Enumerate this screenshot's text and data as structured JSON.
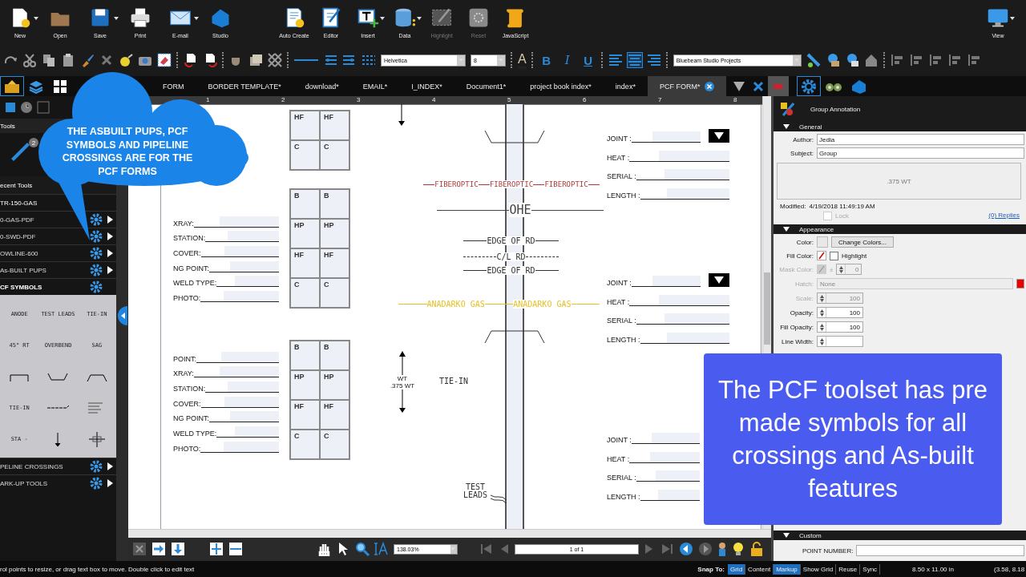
{
  "ribbon": {
    "groups": [
      [
        {
          "label": "New",
          "disabled": false
        },
        {
          "label": "Open",
          "disabled": false
        },
        {
          "label": "Save",
          "disabled": false
        },
        {
          "label": "Print",
          "disabled": false
        },
        {
          "label": "E-mail",
          "disabled": false
        },
        {
          "label": "Studio",
          "disabled": false
        }
      ],
      [
        {
          "label": "Auto Create",
          "disabled": false
        },
        {
          "label": "Editor",
          "disabled": false
        },
        {
          "label": "Insert",
          "disabled": false
        },
        {
          "label": "Data",
          "disabled": false
        },
        {
          "label": "Highlight",
          "disabled": true
        },
        {
          "label": "Reset",
          "disabled": true
        },
        {
          "label": "JavaScript",
          "disabled": false
        }
      ]
    ],
    "view": {
      "label": "View"
    }
  },
  "format_bar": {
    "font": "Helvetica",
    "size": "8",
    "color_glyph": "A",
    "styles": [
      {
        "label": "B",
        "kind": "bold"
      },
      {
        "label": "I",
        "kind": "italic"
      },
      {
        "label": "U",
        "kind": "underline"
      }
    ],
    "align": [
      {
        "selected": false
      },
      {
        "selected": true
      },
      {
        "selected": false
      }
    ],
    "profile": "Bluebeam Studio Projects"
  },
  "tabs": [
    {
      "label": "FORM",
      "selected": false
    },
    {
      "label": "BORDER TEMPLATE*",
      "selected": false
    },
    {
      "label": "download*",
      "selected": false
    },
    {
      "label": "EMAIL*",
      "selected": false
    },
    {
      "label": "I_INDEX*",
      "selected": false
    },
    {
      "label": "Document1*",
      "selected": false
    },
    {
      "label": "project book index*",
      "selected": false
    },
    {
      "label": "index*",
      "selected": false
    },
    {
      "label": "PCF FORM*",
      "selected": true
    }
  ],
  "tools_panel": {
    "header": "Tools",
    "badge": "2",
    "recent": {
      "label": "ecent Tools",
      "items": [
        "TR-150-GAS"
      ]
    },
    "toolsets": [
      {
        "label": "0-GAS-PDF",
        "expanded": false
      },
      {
        "label": "0-SWD-PDF",
        "expanded": false
      },
      {
        "label": "OWLINE-600",
        "expanded": false
      },
      {
        "label": "As-BUILT PUPS",
        "expanded": false
      },
      {
        "label": "CF SYMBOLS",
        "expanded": true
      },
      {
        "label": "PELINE CROSSINGS",
        "expanded": false
      },
      {
        "label": "ARK-UP TOOLS",
        "expanded": false
      }
    ],
    "symbols": [
      {
        "kind": "text",
        "label": "ANODE"
      },
      {
        "kind": "text",
        "label": "TEST LEADS"
      },
      {
        "kind": "text",
        "label": "TIE-IN"
      },
      {
        "kind": "text",
        "label": "45° RT"
      },
      {
        "kind": "text",
        "label": "OVERBEND"
      },
      {
        "kind": "text",
        "label": "SAG"
      },
      {
        "kind": "drawing"
      },
      {
        "kind": "drawing"
      },
      {
        "kind": "drawing"
      },
      {
        "kind": "text",
        "label": "TIE-IN"
      },
      {
        "kind": "drawing"
      },
      {
        "kind": "drawing"
      },
      {
        "kind": "text",
        "label": "STA -"
      },
      {
        "kind": "drawing"
      },
      {
        "kind": "drawing"
      }
    ]
  },
  "document": {
    "ruler": [
      "1",
      "2",
      "3",
      "4",
      "5",
      "6",
      "7",
      "8"
    ],
    "left_forms": [
      {
        "fields": [
          "XRAY:",
          "STATION:",
          "COVER:",
          "NG POINT:",
          "WELD TYPE:",
          "PHOTO:"
        ]
      },
      {
        "fields": [
          "POINT:",
          "XRAY:",
          "STATION:",
          "COVER:",
          "NG POINT:",
          "WELD TYPE:",
          "PHOTO:"
        ]
      }
    ],
    "grids": [
      [
        "HF",
        "HF",
        "C",
        "C"
      ],
      [
        "B",
        "B",
        "HP",
        "HP",
        "HF",
        "HF",
        "C",
        "C"
      ],
      [
        "B",
        "B",
        "HP",
        "HP",
        "HF",
        "HF",
        "C",
        "C"
      ]
    ],
    "utility_lines": [
      {
        "kind": "fiber",
        "labels": [
          "FIBEROPTIC",
          "FIBEROPTIC",
          "FIBEROPTIC"
        ]
      },
      {
        "kind": "overhead",
        "labels": [
          "OHE"
        ]
      },
      {
        "kind": "road_edge",
        "labels": [
          "EDGE OF RD"
        ]
      },
      {
        "kind": "road_center",
        "labels": [
          "C/L RD"
        ]
      },
      {
        "kind": "road_edge",
        "labels": [
          "EDGE OF RD"
        ]
      },
      {
        "kind": "gas",
        "labels": [
          "ANADARKO GAS",
          "ANADARKO GAS"
        ]
      }
    ],
    "wall_thickness": [
      "WT",
      ".375 WT"
    ],
    "tie_in": "TIE-IN",
    "test_leads": "TEST LEADS",
    "right_forms": [
      {
        "dropdown": true,
        "fields": [
          "JOINT :",
          "HEAT :",
          "SERIAL :",
          "LENGTH :"
        ]
      },
      {
        "dropdown": true,
        "fields": [
          "JOINT :",
          "HEAT :",
          "SERIAL :",
          "LENGTH :"
        ]
      },
      {
        "dropdown": false,
        "fields": [
          "JOINT :",
          "HEAT :",
          "SERIAL :",
          "LENGTH :"
        ]
      }
    ]
  },
  "properties": {
    "title": "Group Annotation",
    "general": {
      "header": "General",
      "author_label": "Author:",
      "author": "Jedia",
      "subject_label": "Subject:",
      "subject": "Group",
      "comment": ".375 WT",
      "modified_label": "Modified:",
      "modified": "4/19/2018 11:49:19 AM",
      "lock": {
        "label": "Lock",
        "checked": false,
        "disabled": true
      },
      "replies": "(0) Replies"
    },
    "appearance": {
      "header": "Appearance",
      "rows": [
        {
          "kind": "color",
          "label": "Color:",
          "button": "Change Colors..."
        },
        {
          "kind": "fill",
          "label": "Fill Color:",
          "option": "Highlight",
          "checked": false
        },
        {
          "kind": "mask",
          "label": "Mask Color:",
          "sign": "±",
          "value": "0",
          "disabled": true
        },
        {
          "kind": "select",
          "label": "Hatch:",
          "value": "None",
          "disabled": true
        },
        {
          "kind": "spin",
          "label": "Scale:",
          "value": "100",
          "disabled": true
        },
        {
          "kind": "spin",
          "label": "Opacity:",
          "value": "100",
          "disabled": false
        },
        {
          "kind": "spin",
          "label": "Fill Opacity:",
          "value": "100",
          "disabled": false
        },
        {
          "kind": "spin",
          "label": "Line Width:",
          "disabled": false
        }
      ]
    },
    "custom": {
      "header": "Custom",
      "label": "POINT NUMBER:"
    }
  },
  "nav": {
    "zoom": "138.03%",
    "page": "1 of 1"
  },
  "status": {
    "message": "rol points to resize, or drag text box to move. Double click to edit text",
    "snap_label": "Snap To:",
    "toggles": [
      {
        "label": "Grid",
        "on": true
      },
      {
        "label": "Content",
        "on": false
      },
      {
        "label": "Markup",
        "on": true
      },
      {
        "label": "Show Grid",
        "on": false
      },
      {
        "label": "Reuse",
        "on": false
      },
      {
        "label": "Sync",
        "on": false
      }
    ],
    "size": "8.50 x 11.00 in",
    "coords": "(3.58, 8.18"
  },
  "callout": "THE ASBUILT PUPS, PCF SYMBOLS AND PIPELINE CROSSINGS ARE FOR THE PCF FORMS",
  "caption": "The PCF toolset has pre made symbols for all crossings and As-built features"
}
